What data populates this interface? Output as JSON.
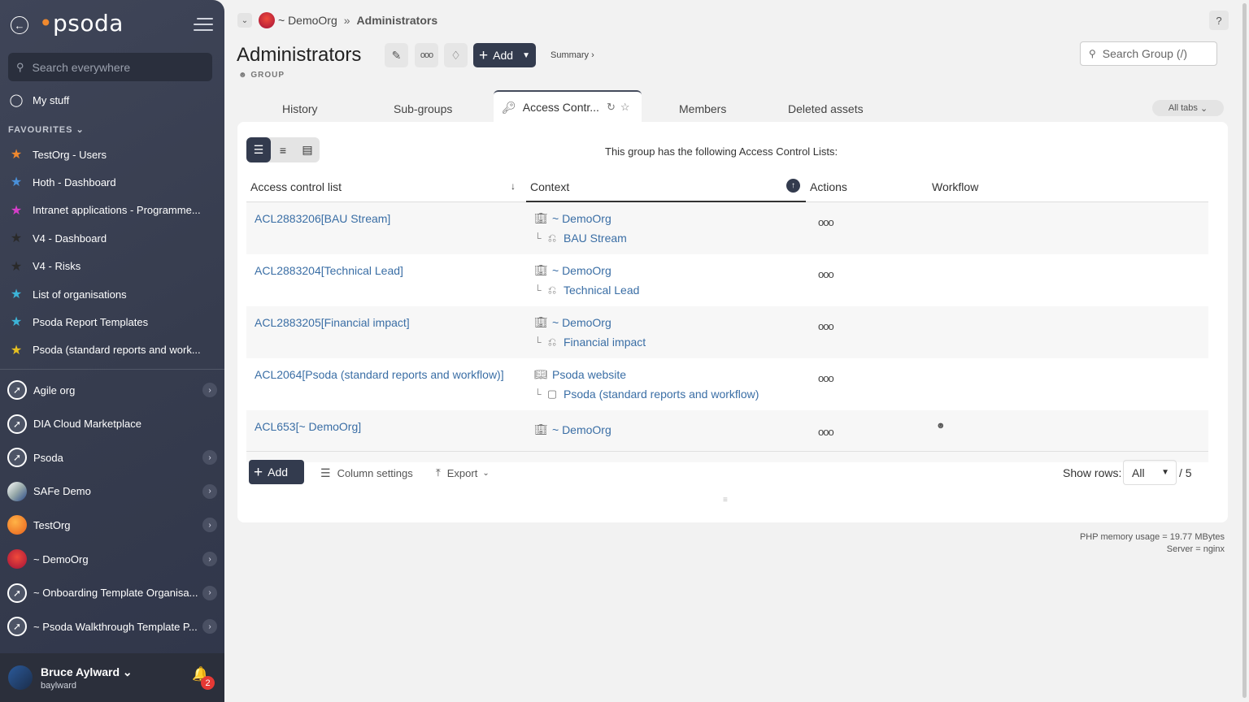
{
  "sidebar": {
    "logo": "psoda",
    "search_placeholder": "Search everywhere",
    "my_stuff": "My stuff",
    "favourites_heading": "FAVOURITES",
    "favourites": [
      {
        "label": "TestOrg - Users",
        "color": "#f0892e"
      },
      {
        "label": "Hoth - Dashboard",
        "color": "#4a90d9"
      },
      {
        "label": "Intranet applications - Programme...",
        "color": "#d63ec9"
      },
      {
        "label": "V4 - Dashboard",
        "color": "#2a2a2a"
      },
      {
        "label": "V4 - Risks",
        "color": "#2a2a2a"
      },
      {
        "label": "List of organisations",
        "color": "#3cb4d8"
      },
      {
        "label": "Psoda Report Templates",
        "color": "#3cb4d8"
      },
      {
        "label": "Psoda (standard reports and work...",
        "color": "#e6c020"
      }
    ],
    "orgs": [
      {
        "label": "Agile org",
        "icon": "compass-icon",
        "chev": true
      },
      {
        "label": "DIA Cloud Marketplace",
        "icon": "compass-icon",
        "chev": false
      },
      {
        "label": "Psoda",
        "icon": "compass-icon",
        "chev": true
      },
      {
        "label": "SAFe Demo",
        "icon": "safe-logo-icon",
        "chev": true
      },
      {
        "label": "TestOrg",
        "icon": "testorg-logo-icon",
        "chev": true
      },
      {
        "label": "~ DemoOrg",
        "icon": "demoorg-logo-icon",
        "chev": true
      },
      {
        "label": "~ Onboarding Template Organisa...",
        "icon": "compass-icon",
        "chev": true
      },
      {
        "label": "~ Psoda Walkthrough Template P...",
        "icon": "compass-icon",
        "chev": true
      }
    ],
    "user": {
      "name": "Bruce Aylward",
      "username": "baylward",
      "notifications": "2"
    }
  },
  "breadcrumb": {
    "org": "~ DemoOrg",
    "separator": "»",
    "current": "Administrators"
  },
  "page": {
    "title": "Administrators",
    "type_label": "GROUP",
    "add_label": "Add",
    "summary_label": "Summary ›",
    "search_placeholder": "Search Group (/)"
  },
  "tabs": {
    "items": [
      "History",
      "Sub-groups",
      "Members",
      "Deleted assets"
    ],
    "active": "Access Contr...",
    "all_tabs": "All tabs"
  },
  "table": {
    "intro": "This group has the following Access Control Lists:",
    "headers": {
      "acl": "Access control list",
      "context": "Context",
      "actions": "Actions",
      "workflow": "Workflow"
    },
    "rows": [
      {
        "acl": "ACL2883206[BAU Stream]",
        "ctx1": "~ DemoOrg",
        "ctx2": "BAU Stream",
        "actions": "ooo"
      },
      {
        "acl": "ACL2883204[Technical Lead]",
        "ctx1": "~ DemoOrg",
        "ctx2": "Technical Lead",
        "actions": "ooo"
      },
      {
        "acl": "ACL2883205[Financial impact]",
        "ctx1": "~ DemoOrg",
        "ctx2": "Financial impact",
        "actions": "ooo"
      },
      {
        "acl": "ACL2064[Psoda (standard reports and workflow)]",
        "ctx1": "Psoda website",
        "ctx2": "Psoda (standard reports and workflow)",
        "actions": "ooo"
      },
      {
        "acl": "ACL653[~ DemoOrg]",
        "ctx1": "~ DemoOrg",
        "ctx2": "",
        "actions": "ooo"
      }
    ]
  },
  "footer_bar": {
    "add_label": "Add",
    "column_settings": "Column settings",
    "export": "Export",
    "show_rows_label": "Show rows:",
    "show_rows_value": "All",
    "total": "/ 5"
  },
  "server": {
    "memory": "PHP memory usage = 19.77 MBytes",
    "server": "Server = nginx"
  }
}
